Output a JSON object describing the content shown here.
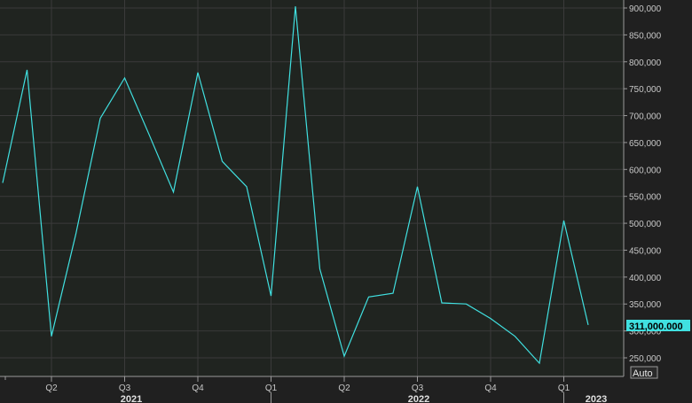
{
  "chart_data": {
    "type": "line",
    "x": [
      "2021-02",
      "2021-03",
      "2021-04",
      "2021-05",
      "2021-06",
      "2021-07",
      "2021-08",
      "2021-09",
      "2021-10",
      "2021-11",
      "2021-12",
      "2022-01",
      "2022-02",
      "2022-03",
      "2022-04",
      "2022-05",
      "2022-06",
      "2022-07",
      "2022-08",
      "2022-09",
      "2022-10",
      "2022-11",
      "2022-12",
      "2023-01",
      "2023-02"
    ],
    "series": [
      {
        "values": [
          575000,
          785000,
          290000,
          480000,
          695000,
          770000,
          665000,
          558000,
          780000,
          615000,
          568000,
          365000,
          903000,
          415000,
          253000,
          363000,
          370000,
          568000,
          352000,
          350000,
          323000,
          290000,
          240000,
          505000,
          311000
        ],
        "color": "#40e0e0"
      }
    ],
    "ylim": [
      215000,
      910000
    ],
    "yticks": [
      "900,000",
      "850,000",
      "800,000",
      "750,000",
      "700,000",
      "650,000",
      "600,000",
      "550,000",
      "500,000",
      "450,000",
      "400,000",
      "350,000",
      "300,000",
      "250,000"
    ],
    "quarter_labels": [
      "Q2",
      "Q3",
      "Q4",
      "Q1",
      "Q2",
      "Q3",
      "Q4",
      "Q1"
    ],
    "year_labels": [
      "2021",
      "2022",
      "2023"
    ],
    "last_value_label": "311,000.000",
    "scale_button": "Auto",
    "grid": true,
    "colors": {
      "background": "#202020",
      "plot_background": "#202420",
      "grid": "#3a3a3a",
      "line": "#40e0e0",
      "last_value_box": "#40e0e0"
    }
  }
}
